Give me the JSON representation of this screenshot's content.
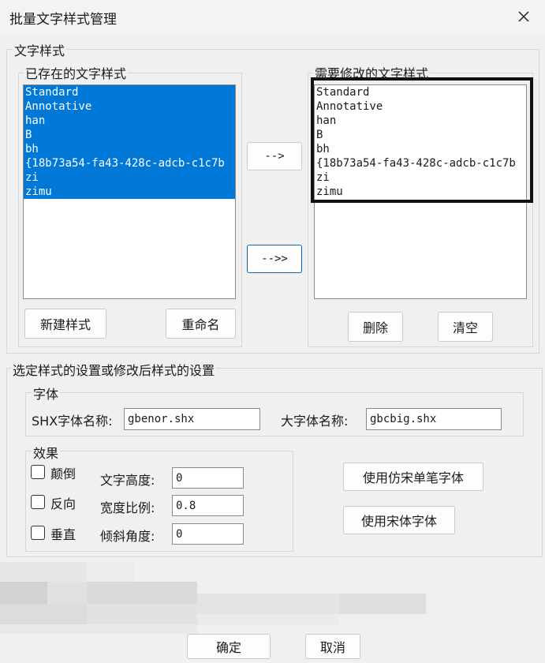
{
  "window": {
    "title": "批量文字样式管理"
  },
  "text_style_group": {
    "legend": "文字样式",
    "existing_label": "已存在的文字样式",
    "target_label": "需要修改的文字样式",
    "existing_items": [
      "Standard",
      "Annotative",
      "han",
      "B",
      "bh",
      "{18b73a54-fa43-428c-adcb-c1c7b",
      "zi",
      "zimu"
    ],
    "target_items": [
      "Standard",
      "Annotative",
      "han",
      "B",
      "bh",
      "{18b73a54-fa43-428c-adcb-c1c7b",
      "zi",
      "zimu"
    ],
    "add_button": "-->",
    "add_all_button": "-->>",
    "new_style_button": "新建样式",
    "rename_button": "重命名",
    "delete_button": "删除",
    "clear_button": "清空"
  },
  "settings_group": {
    "legend": "选定样式的设置或修改后样式的设置",
    "font_group": {
      "legend": "字体",
      "shx_label": "SHX字体名称:",
      "shx_value": "gbenor.shx",
      "big_label": "大字体名称:",
      "big_value": "gbcbig.shx"
    },
    "effect_group": {
      "legend": "效果",
      "upside_down": "颠倒",
      "backwards": "反向",
      "vertical": "垂直",
      "height_label": "文字高度:",
      "height_value": "0",
      "width_label": "宽度比例:",
      "width_value": "0.8",
      "oblique_label": "倾斜角度:",
      "oblique_value": "0"
    },
    "fangsong_button": "使用仿宋单笔字体",
    "song_button": "使用宋体字体"
  },
  "footer": {
    "ok_button": "确定",
    "cancel_button": "取消"
  },
  "colors": {
    "selection": "#0078d7",
    "background": "#f0f0f0"
  }
}
